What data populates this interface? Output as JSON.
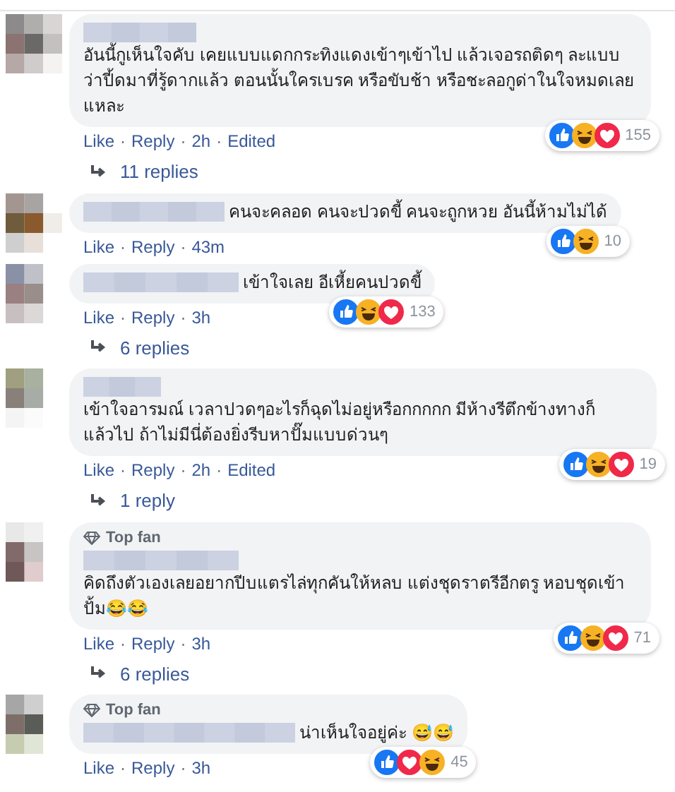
{
  "separator": "·",
  "comments": [
    {
      "text": "อันนี้กูเห็นใจคับ เคยแบบแดกกระทิงแดงเข้าๆเข้าไป แล้วเจอรถติดๆ ละแบบว่าปี้ดมาที่รู้ดากแล้ว ตอนนั้นใครเบรค หรือขับช้า หรือชะลอกูด่าในใจหมดเลยแหละ",
      "reactions": [
        {
          "kind": "like"
        },
        {
          "kind": "haha"
        },
        {
          "kind": "love"
        }
      ],
      "reaction_count": "155",
      "actions": [
        "Like",
        "Reply"
      ],
      "time": "2h",
      "edited": "Edited",
      "replies": "11 replies"
    },
    {
      "text": "คนจะคลอด คนจะปวดขี้ คนจะถูกหวย อันนี้ห้ามไม่ได้",
      "reactions": [
        {
          "kind": "like"
        },
        {
          "kind": "haha"
        }
      ],
      "reaction_count": "10",
      "actions": [
        "Like",
        "Reply"
      ],
      "time": "43m"
    },
    {
      "text": "เข้าใจเลย อีเหี้ยคนปวดขี้",
      "reactions": [
        {
          "kind": "like"
        },
        {
          "kind": "haha"
        },
        {
          "kind": "love"
        }
      ],
      "reaction_count": "133",
      "actions": [
        "Like",
        "Reply"
      ],
      "time": "3h",
      "replies": "6 replies"
    },
    {
      "text": "เข้าใจอารมณ์ เวลาปวดๆอะไรก็ฉุดไม่อยู่หรือกกกกก มีห้างรีตึกข้างทางก็แล้วไป ถ้าไม่มีนี่ต้องยิ่งรีบหาปั๊มแบบด่วนๆ",
      "reactions": [
        {
          "kind": "like"
        },
        {
          "kind": "haha"
        },
        {
          "kind": "love"
        }
      ],
      "reaction_count": "19",
      "actions": [
        "Like",
        "Reply"
      ],
      "time": "2h",
      "edited": "Edited",
      "replies": "1 reply"
    },
    {
      "badge": "Top fan",
      "text": "คิดถึงตัวเองเลยอยากปีบแตรไล่ทุกคันให้หลบ แต่งชุดราตรีอีกตรู หอบชุดเข้าปั้ม😂😂",
      "reactions": [
        {
          "kind": "like"
        },
        {
          "kind": "haha"
        },
        {
          "kind": "love"
        }
      ],
      "reaction_count": "71",
      "actions": [
        "Like",
        "Reply"
      ],
      "time": "3h",
      "replies": "6 replies"
    },
    {
      "badge": "Top fan",
      "text": "น่าเห็นใจอยู่ค่ะ 😅😅",
      "reactions": [
        {
          "kind": "like"
        },
        {
          "kind": "love"
        },
        {
          "kind": "haha"
        }
      ],
      "reaction_count": "45",
      "actions": [
        "Like",
        "Reply"
      ],
      "time": "3h"
    }
  ]
}
